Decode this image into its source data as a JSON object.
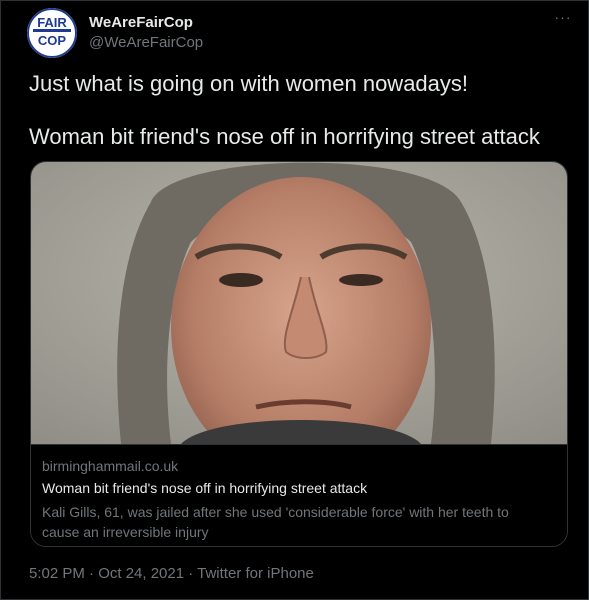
{
  "author": {
    "display_name": "WeAreFairCop",
    "handle": "@WeAreFairCop",
    "avatar_text_top": "FAIR",
    "avatar_text_bottom": "COP"
  },
  "more_label": "···",
  "tweet": {
    "line1": "Just what is going on with women nowadays!",
    "line2": "Woman bit friend's nose off in horrifying street attack"
  },
  "card": {
    "image_icon": "mugshot-photo",
    "domain": "birminghammail.co.uk",
    "title": "Woman bit friend's nose off in horrifying street attack",
    "description": "Kali Gills, 61, was jailed after she used 'considerable force' with her teeth to cause an irreversible injury"
  },
  "timestamp": "5:02 PM · Oct 24, 2021 · Twitter for iPhone",
  "colors": {
    "background": "#000000",
    "text": "#e7e9ea",
    "secondary": "#71767b",
    "border": "#2f3336",
    "avatar_brand": "#1d3c8f"
  }
}
